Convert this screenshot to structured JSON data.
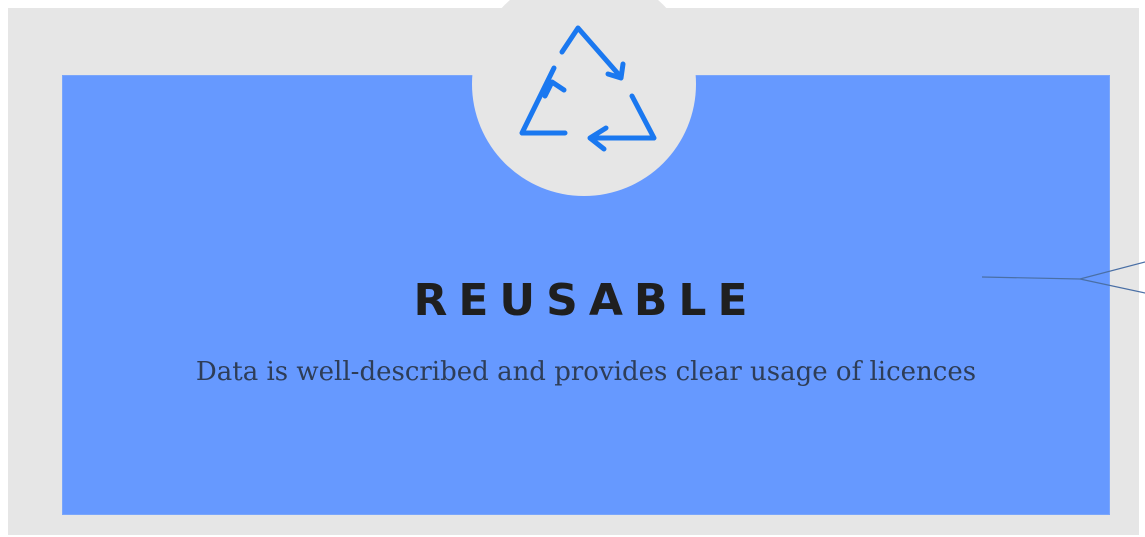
{
  "card": {
    "title": "REUSABLE",
    "description": "Data is well-described and provides clear usage of licences"
  },
  "icon": {
    "name": "recycle-icon",
    "color": "#1a78f0"
  },
  "colors": {
    "card_background": "#6699ff",
    "panel_background": "#e6e6e6",
    "title_text": "#1f1f1f",
    "description_text": "#2e3d57",
    "connector_line": "#4a6fa5"
  }
}
